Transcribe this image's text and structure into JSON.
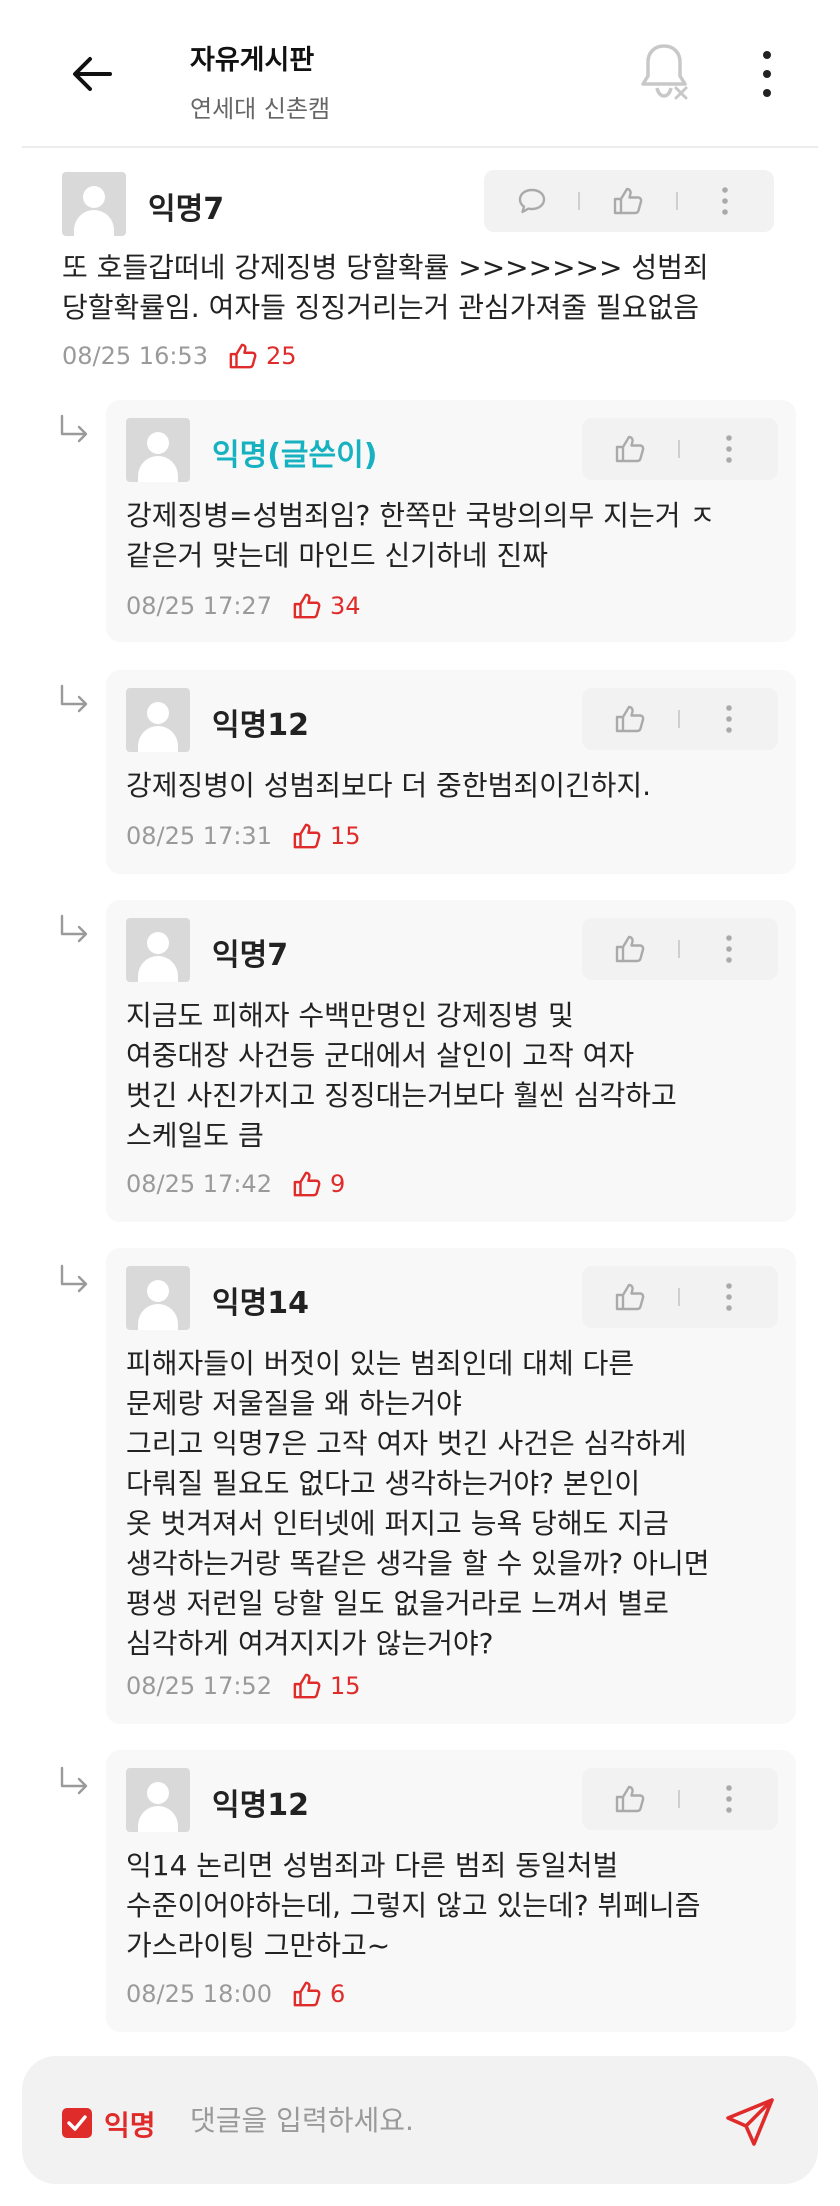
{
  "header": {
    "title": "자유게시판",
    "subtitle": "연세대 신촌캠"
  },
  "main_comment": {
    "nickname": "익명7",
    "text": "또 호들갑떠네 강제징병 당할확률 >>>>>>> 성범죄\n당할확률임. 여자들 징징거리는거 관심가져줄 필요없음",
    "time": "08/25 16:53",
    "likes": "25"
  },
  "replies": [
    {
      "nickname": "익명(글쓴이)",
      "text": "강제징병=성범죄임? 한쪽만 국방의의무 지는거 ㅈ\n같은거 맞는데 마인드 신기하네 진짜",
      "time": "08/25 17:27",
      "likes": "34"
    },
    {
      "nickname": "익명12",
      "text": "강제징병이 성범죄보다 더 중한범죄이긴하지.",
      "time": "08/25 17:31",
      "likes": "15"
    },
    {
      "nickname": "익명7",
      "text": "지금도 피해자 수백만명인 강제징병 및\n여중대장 사건등 군대에서 살인이 고작 여자\n벗긴 사진가지고 징징대는거보다 훨씬 심각하고\n스케일도 큼",
      "time": "08/25 17:42",
      "likes": "9"
    },
    {
      "nickname": "익명14",
      "text": "피해자들이 버젓이 있는 범죄인데 대체 다른\n문제랑 저울질을 왜 하는거야\n그리고 익명7은 고작 여자 벗긴 사건은 심각하게\n다뤄질 필요도 없다고 생각하는거야? 본인이\n옷 벗겨져서 인터넷에 퍼지고 능욕 당해도 지금\n생각하는거랑 똑같은 생각을 할 수 있을까? 아니면\n평생 저런일 당할 일도 없을거라로 느껴서 별로\n심각하게 여겨지지가 않는거야?",
      "time": "08/25 17:52",
      "likes": "15"
    },
    {
      "nickname": "익명12",
      "text": "익14 논리면 성범죄과 다른 범죄 동일처벌\n수준이어야하는데, 그렇지 않고 있는데? 뷔페니즘\n가스라이팅 그만하고~",
      "time": "08/25 18:00",
      "likes": "6"
    }
  ],
  "footer": {
    "anonymous_label": "익명",
    "anonymous_checked": true,
    "input_placeholder": "댓글을 입력하세요."
  },
  "colors": {
    "accent_red": "#e02b2b",
    "op_teal": "#17b2c1"
  },
  "icons": [
    "back-arrow-icon",
    "bell-off-icon",
    "more-vertical-icon",
    "comment-icon",
    "thumbs-up-icon",
    "reply-arrow-icon",
    "check-icon",
    "send-icon"
  ]
}
